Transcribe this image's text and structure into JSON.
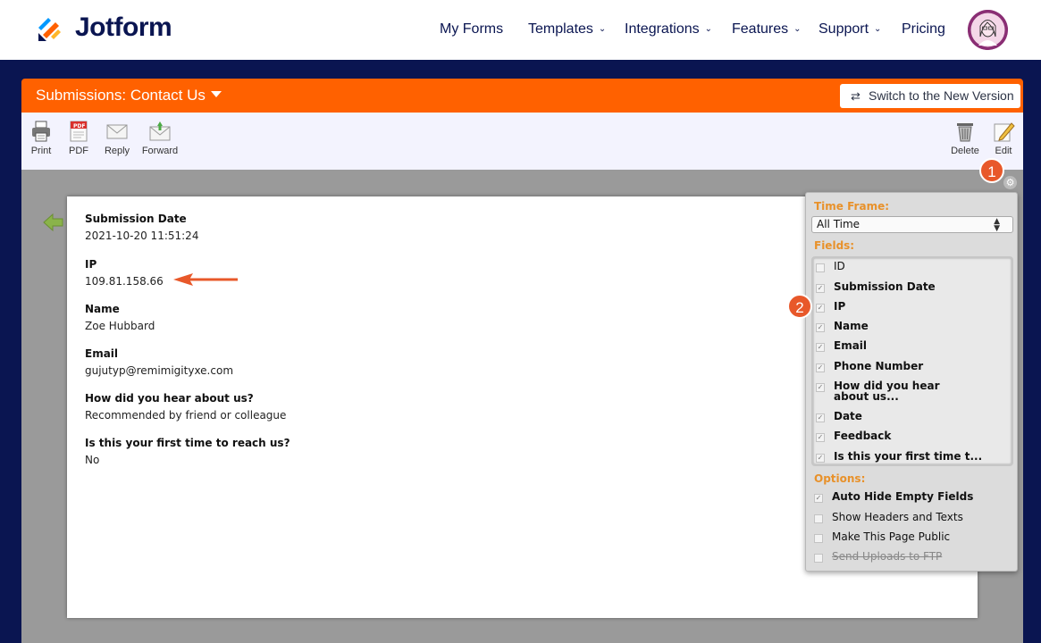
{
  "brand": {
    "name": "Jotform"
  },
  "nav": {
    "items": [
      {
        "label": "My Forms",
        "dropdown": false
      },
      {
        "label": "Templates",
        "dropdown": true
      },
      {
        "label": "Integrations",
        "dropdown": true
      },
      {
        "label": "Features",
        "dropdown": true
      },
      {
        "label": "Support",
        "dropdown": true
      },
      {
        "label": "Pricing",
        "dropdown": false
      }
    ],
    "chevron": "⌄"
  },
  "header": {
    "title": "Submissions: Contact Us",
    "switch_label": "Switch to the New Version",
    "switch_icon": "⇄"
  },
  "toolbar": {
    "print": "Print",
    "pdf": "PDF",
    "reply": "Reply",
    "forward": "Forward",
    "delete": "Delete",
    "edit": "Edit"
  },
  "submission": {
    "fields": [
      {
        "label": "Submission Date",
        "value": "2021-10-20 11:51:24"
      },
      {
        "label": "IP",
        "value": "109.81.158.66"
      },
      {
        "label": "Name",
        "value": "Zoe Hubbard"
      },
      {
        "label": "Email",
        "value": "gujutyp@remimigityxe.com"
      },
      {
        "label": "How did you hear about us?",
        "value": "Recommended by friend or colleague"
      },
      {
        "label": "Is this your first time to reach us?",
        "value": "No"
      }
    ]
  },
  "annotations": {
    "badge1": "1",
    "badge2": "2"
  },
  "panel": {
    "timeframe_title": "Time Frame:",
    "timeframe_value": "All Time",
    "fields_title": "Fields:",
    "fields": [
      {
        "label": "ID",
        "checked": false
      },
      {
        "label": "Submission Date",
        "checked": true
      },
      {
        "label": "IP",
        "checked": true
      },
      {
        "label": "Name",
        "checked": true
      },
      {
        "label": "Email",
        "checked": true
      },
      {
        "label": "Phone Number",
        "checked": true
      },
      {
        "label": "How did you hear about us...",
        "checked": true
      },
      {
        "label": "Date",
        "checked": true
      },
      {
        "label": "Feedback",
        "checked": true
      },
      {
        "label": "Is this your first time t...",
        "checked": true
      }
    ],
    "options_title": "Options:",
    "options": [
      {
        "label": "Auto Hide Empty Fields",
        "checked": true
      },
      {
        "label": "Show Headers and Texts",
        "checked": false
      },
      {
        "label": "Make This Page Public",
        "checked": false
      },
      {
        "label": "Send Uploads to FTP",
        "checked": false
      }
    ],
    "check_glyph": "✓"
  },
  "colors": {
    "brand_navy": "#0a1551",
    "accent_orange": "#ff6100",
    "badge": "#e8582a"
  },
  "icons": [
    "jotform-logo-icon",
    "user-avatar-icon",
    "print-icon",
    "pdf-icon",
    "reply-icon",
    "forward-icon",
    "delete-icon",
    "edit-icon",
    "back-arrow-icon",
    "gear-icon"
  ]
}
